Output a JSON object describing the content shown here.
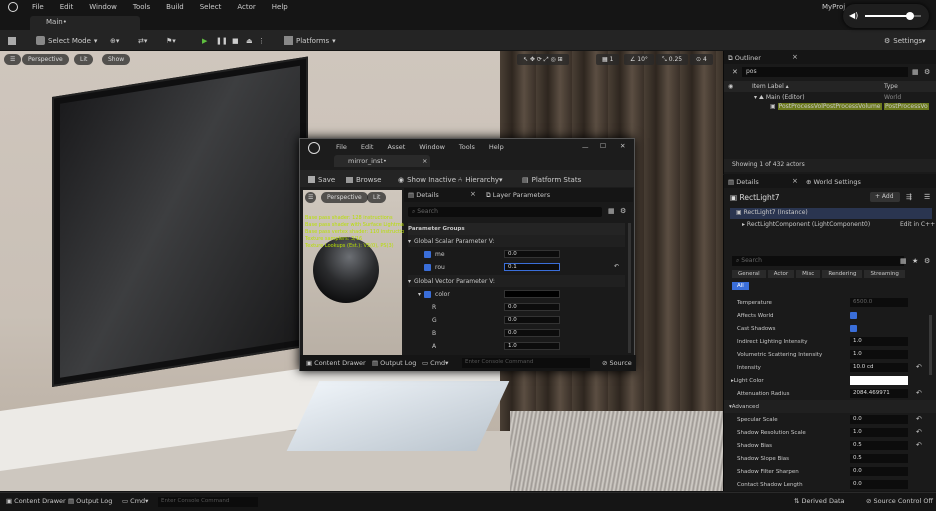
{
  "menu": [
    "File",
    "Edit",
    "Window",
    "Tools",
    "Build",
    "Select",
    "Actor",
    "Help"
  ],
  "project": "MyProj",
  "tab": "Main•",
  "toolbar": {
    "select_mode": "Select Mode",
    "platforms": "Platforms",
    "settings": "Settings",
    "snap1": "1",
    "snap2": "10°",
    "snap3": "0.25",
    "cam": "4"
  },
  "viewport": {
    "perspective": "Perspective",
    "lit": "Lit",
    "show": "Show"
  },
  "material_editor": {
    "menu": [
      "File",
      "Edit",
      "Asset",
      "Window",
      "Tools",
      "Help"
    ],
    "tab": "mirror_inst•",
    "save": "Save",
    "browse": "Browse",
    "show_inactive": "Show Inactive",
    "hierarchy": "Hierarchy",
    "platform_stats": "Platform Stats",
    "preview": {
      "perspective": "Perspective",
      "lit": "Lit",
      "stats": [
        "Base pass shader: 128 instructions",
        "Base pass shader with Surface Lightmap",
        "Base pass vertex shader: 110 instruction",
        "Texture samplers: 3/16",
        "Texture Lookups (Est.): VS(0), PS(3)"
      ]
    },
    "details_tab": "Details",
    "layer_tab": "Layer Parameters",
    "search": "Search",
    "param_groups": "Parameter Groups",
    "scalar_group": "Global Scalar Parameter V:",
    "vector_group": "Global Vector Parameter V:",
    "scalars": [
      {
        "name": "me",
        "value": "0.0"
      },
      {
        "name": "rou",
        "value": "0.1"
      }
    ],
    "vector_name": "color",
    "channels": [
      {
        "name": "R",
        "value": "0.0"
      },
      {
        "name": "G",
        "value": "0.0"
      },
      {
        "name": "B",
        "value": "0.0"
      },
      {
        "name": "A",
        "value": "1.0"
      }
    ],
    "content_drawer": "Content Drawer",
    "output_log": "Output Log",
    "cmd": "Cmd",
    "console": "Enter Console Command",
    "source": "Source"
  },
  "outliner": {
    "title": "Outliner",
    "search": "pos",
    "col_label": "Item Label ▴",
    "col_type": "Type",
    "main": "Main (Editor)",
    "main_type": "World",
    "item": "PostProcessVolPostProcessVolume",
    "item_type": "PostProcessVo",
    "count": "Showing 1 of 432 actors"
  },
  "details": {
    "tab": "Details",
    "world": "World Settings",
    "actor": "RectLight7",
    "add": "+ Add",
    "instance": "RectLight7 (Instance)",
    "component": "RectLightComponent (LightComponent0)",
    "edit": "Edit in C++",
    "search": "Search",
    "filters": [
      "General",
      "Actor",
      "Misc",
      "Rendering",
      "Streaming",
      "All"
    ],
    "rows": [
      {
        "label": "Temperature",
        "value": "6500.0",
        "kind": "field"
      },
      {
        "label": "Affects World",
        "value": "",
        "kind": "check"
      },
      {
        "label": "Cast Shadows",
        "value": "",
        "kind": "check"
      },
      {
        "label": "Indirect Lighting Intensity",
        "value": "1.0",
        "kind": "field"
      },
      {
        "label": "Volumetric Scattering Intensity",
        "value": "1.0",
        "kind": "field"
      },
      {
        "label": "Intensity",
        "value": "10.0 cd",
        "kind": "field"
      },
      {
        "label": "Light Color",
        "value": "",
        "kind": "color"
      },
      {
        "label": "Attenuation Radius",
        "value": "2084.469971",
        "kind": "field"
      },
      {
        "label": "Advanced",
        "value": "",
        "kind": "header"
      },
      {
        "label": "Specular Scale",
        "value": "0.0",
        "kind": "field"
      },
      {
        "label": "Shadow Resolution Scale",
        "value": "1.0",
        "kind": "field"
      },
      {
        "label": "Shadow Bias",
        "value": "0.5",
        "kind": "field"
      },
      {
        "label": "Shadow Slope Bias",
        "value": "0.5",
        "kind": "field"
      },
      {
        "label": "Shadow Filter Sharpen",
        "value": "0.0",
        "kind": "field"
      },
      {
        "label": "Contact Shadow Length",
        "value": "0.0",
        "kind": "field"
      }
    ]
  },
  "statusbar": {
    "content_drawer": "Content Drawer",
    "output_log": "Output Log",
    "cmd": "Cmd",
    "console": "Enter Console Command",
    "derived": "Derived Data",
    "source": "Source Control Off"
  },
  "volume_level": 0.8
}
